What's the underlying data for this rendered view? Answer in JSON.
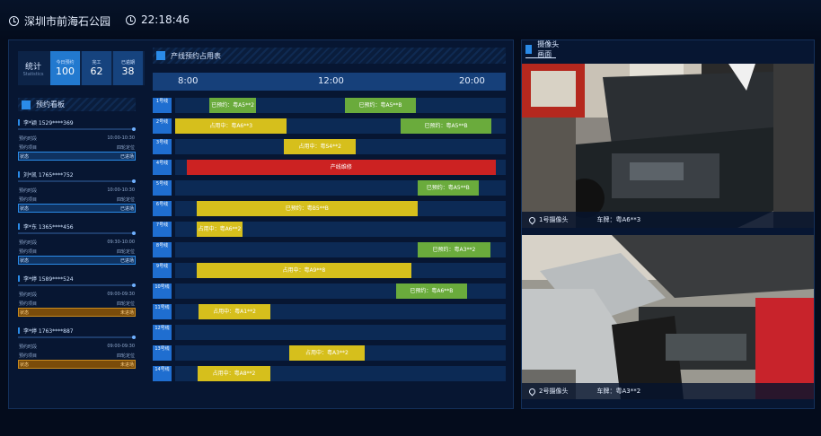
{
  "header": {
    "location": "深圳市前海石公园",
    "time": "22:18:46"
  },
  "stats": {
    "title": "统计",
    "subtitle": "Statistics",
    "items": [
      {
        "key": "今日预约",
        "value": "100"
      },
      {
        "key": "完工",
        "value": "62"
      },
      {
        "key": "已逾期",
        "value": "38"
      }
    ]
  },
  "reservations": {
    "title": "预约看板",
    "row_labels": {
      "time": "预约时段",
      "project": "预约项目",
      "status": "状态"
    },
    "items": [
      {
        "name": "李*颖 1529****369",
        "time": "10:00-10:30",
        "project": "四轮定位",
        "status": "已进场",
        "warn": false
      },
      {
        "name": "刘*凯 1765****752",
        "time": "10:00-10:30",
        "project": "四轮定位",
        "status": "已进场",
        "warn": false
      },
      {
        "name": "李*东 1365****456",
        "time": "09:30-10:00",
        "project": "四轮定位",
        "status": "已进场",
        "warn": false
      },
      {
        "name": "李*婷 1589****524",
        "time": "09:00-09:30",
        "project": "四轮定位",
        "status": "未进场",
        "warn": true
      },
      {
        "name": "李*婷 1763****887",
        "time": "09:00-09:30",
        "project": "四轮定位",
        "status": "未进场",
        "warn": true
      }
    ]
  },
  "gantt": {
    "title": "产线预约占用表",
    "axis": [
      "8:00",
      "12:00",
      "20:00"
    ],
    "lanes": [
      {
        "label": "1号线",
        "blocks": [
          {
            "text": "已预约：粤A5**2",
            "kind": "g",
            "start": 10.3,
            "end": 24.5
          },
          {
            "text": "已预约：粤A5**B",
            "kind": "g",
            "start": 51.4,
            "end": 72.8
          }
        ]
      },
      {
        "label": "2号线",
        "blocks": [
          {
            "text": "占用中：粤A6**3",
            "kind": "y",
            "start": 0,
            "end": 33.8
          },
          {
            "text": "已预约：粤A5**B",
            "kind": "g",
            "start": 68.2,
            "end": 95.7
          }
        ]
      },
      {
        "label": "3号线",
        "blocks": [
          {
            "text": "占用中：粤S4**2",
            "kind": "y",
            "start": 32.9,
            "end": 54.7
          }
        ]
      },
      {
        "label": "4号线",
        "blocks": [
          {
            "text": "产线维修",
            "kind": "r",
            "start": 3.5,
            "end": 96.9
          }
        ]
      },
      {
        "label": "5号线",
        "blocks": [
          {
            "text": "已预约：粤A5**B",
            "kind": "g",
            "start": 73.3,
            "end": 91.8
          }
        ]
      },
      {
        "label": "6号线",
        "blocks": [
          {
            "text": "已预约：粤B5**B",
            "kind": "y",
            "start": 6.5,
            "end": 73.3
          }
        ]
      },
      {
        "label": "7号线",
        "blocks": [
          {
            "text": "占用中：粤A6**2",
            "kind": "y",
            "start": 6.5,
            "end": 20.4
          }
        ]
      },
      {
        "label": "8号线",
        "blocks": [
          {
            "text": "已预约：粤A3**2",
            "kind": "g",
            "start": 73.3,
            "end": 95.4
          }
        ]
      },
      {
        "label": "9号线",
        "blocks": [
          {
            "text": "占用中：粤A9**8",
            "kind": "y",
            "start": 6.5,
            "end": 71.4
          }
        ]
      },
      {
        "label": "10号线",
        "blocks": [
          {
            "text": "已预约：粤A6**B",
            "kind": "g",
            "start": 66.8,
            "end": 88.3
          }
        ]
      },
      {
        "label": "11号线",
        "blocks": [
          {
            "text": "占用中：粤A1**2",
            "kind": "y",
            "start": 7.1,
            "end": 28.8
          }
        ]
      },
      {
        "label": "12号线",
        "blocks": []
      },
      {
        "label": "13号线",
        "blocks": [
          {
            "text": "占用中：粤A3**2",
            "kind": "y",
            "start": 34.5,
            "end": 57.3
          }
        ]
      },
      {
        "label": "14号线",
        "blocks": [
          {
            "text": "占用中：粤A8**2",
            "kind": "y",
            "start": 6.8,
            "end": 28.8
          }
        ]
      }
    ]
  },
  "cameras": {
    "title": "摄像头画面",
    "items": [
      {
        "name": "1号摄像头",
        "plate": "车牌：粤A6**3"
      },
      {
        "name": "2号摄像头",
        "plate": "车牌：粤A3**2"
      }
    ]
  }
}
